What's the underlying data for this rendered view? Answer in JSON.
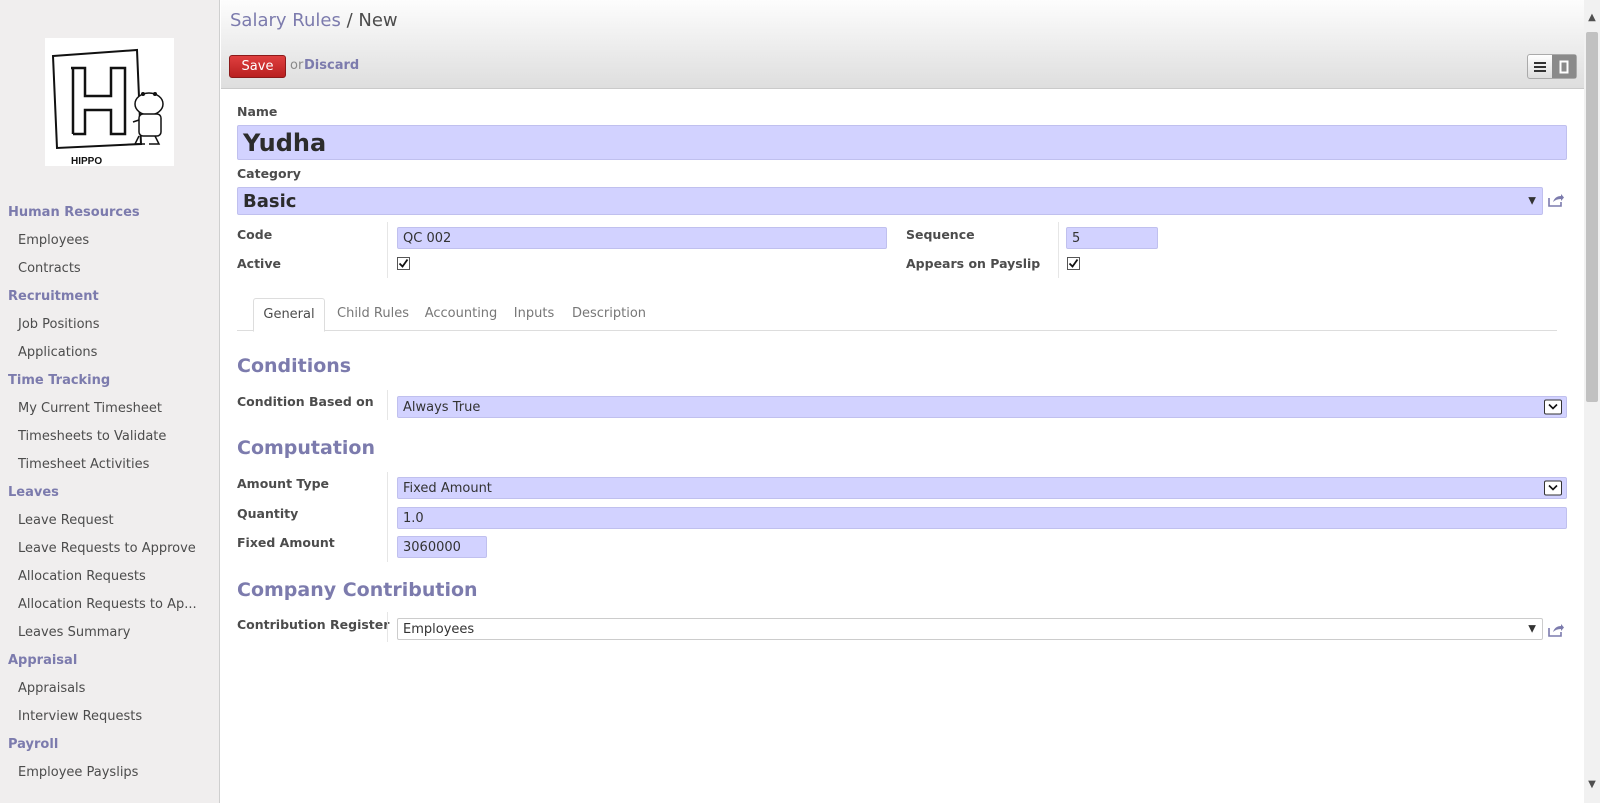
{
  "sidebar": {
    "logo_text": "HIPPO",
    "sections": [
      {
        "title": "Human Resources",
        "items": [
          "Employees",
          "Contracts"
        ]
      },
      {
        "title": "Recruitment",
        "items": [
          "Job Positions",
          "Applications"
        ]
      },
      {
        "title": "Time Tracking",
        "items": [
          "My Current Timesheet",
          "Timesheets to Validate",
          "Timesheet Activities"
        ]
      },
      {
        "title": "Leaves",
        "items": [
          "Leave Request",
          "Leave Requests to Approve",
          "Allocation Requests",
          "Allocation Requests to Ap...",
          "Leaves Summary"
        ]
      },
      {
        "title": "Appraisal",
        "items": [
          "Appraisals",
          "Interview Requests"
        ]
      },
      {
        "title": "Payroll",
        "items": [
          "Employee Payslips"
        ]
      }
    ]
  },
  "header": {
    "breadcrumb_parent": "Salary Rules",
    "breadcrumb_sep": "/",
    "breadcrumb_current": "New",
    "save_label": "Save",
    "or_text": "or",
    "discard_label": "Discard"
  },
  "form": {
    "name_label": "Name",
    "name_value": "Yudha",
    "category_label": "Category",
    "category_value": "Basic",
    "code_label": "Code",
    "code_value": "QC 002",
    "sequence_label": "Sequence",
    "sequence_value": "5",
    "active_label": "Active",
    "active_checked": true,
    "payslip_label": "Appears on Payslip",
    "payslip_checked": true
  },
  "tabs": [
    {
      "label": "General",
      "active": true
    },
    {
      "label": "Child Rules",
      "active": false
    },
    {
      "label": "Accounting",
      "active": false
    },
    {
      "label": "Inputs",
      "active": false
    },
    {
      "label": "Description",
      "active": false
    }
  ],
  "general": {
    "conditions_title": "Conditions",
    "condition_based_label": "Condition Based on",
    "condition_based_value": "Always True",
    "computation_title": "Computation",
    "amount_type_label": "Amount Type",
    "amount_type_value": "Fixed Amount",
    "quantity_label": "Quantity",
    "quantity_value": "1.0",
    "fixed_amount_label": "Fixed Amount",
    "fixed_amount_value": "3060000",
    "company_contribution_title": "Company Contribution",
    "contribution_register_label": "Contribution Register",
    "contribution_register_value": "Employees"
  },
  "colors": {
    "accent": "#7c7bad",
    "field_bg": "#d2d2ff",
    "save_red": "#c92b2b"
  }
}
